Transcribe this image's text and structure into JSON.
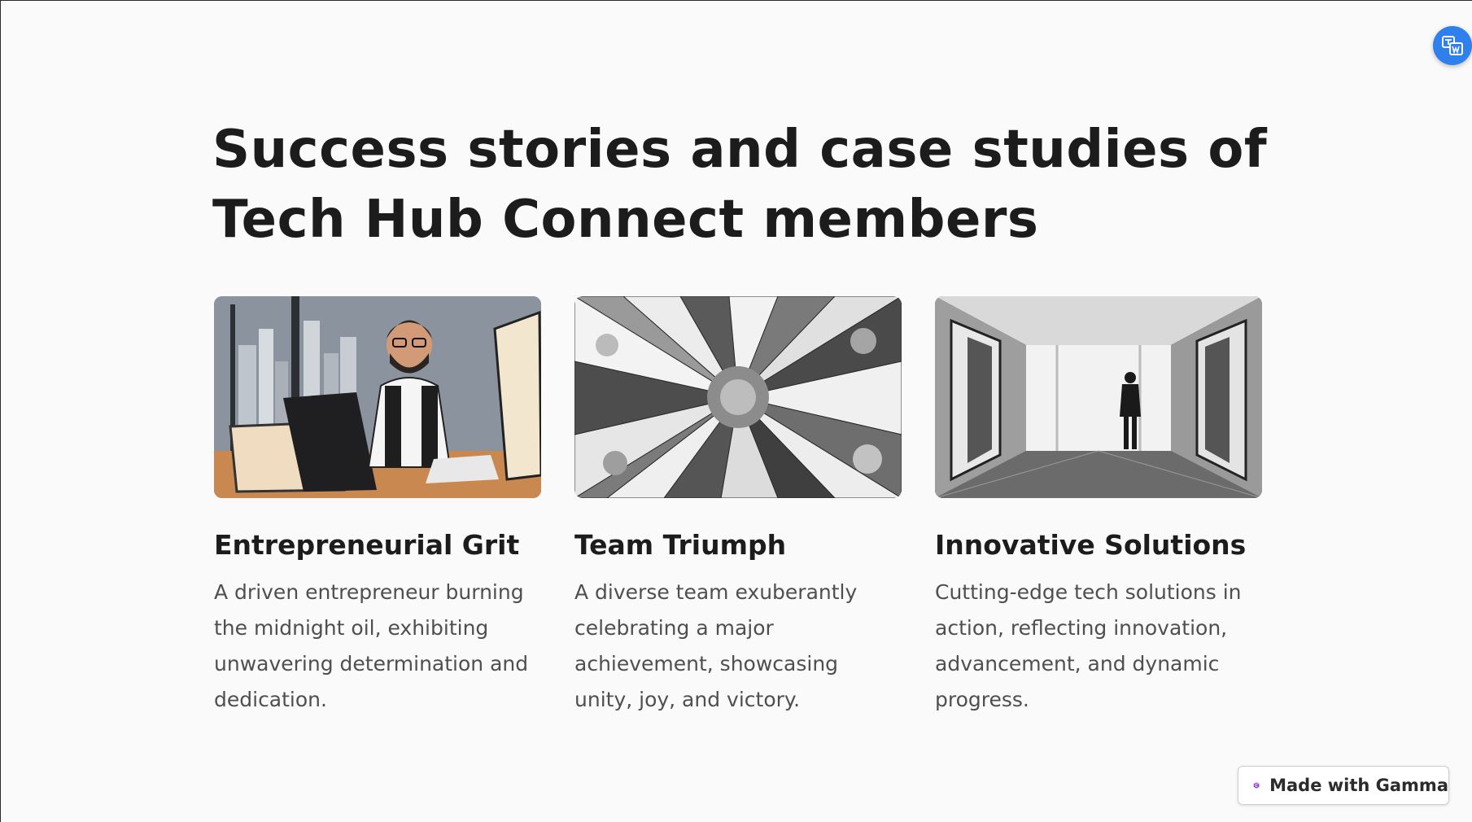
{
  "title": "Success stories and case studies of Tech Hub Connect members",
  "cards": [
    {
      "image_icon": "entrepreneur-at-laptop-illustration",
      "title": "Entrepreneurial Grit",
      "description": "A driven entrepreneur burning the midnight oil, exhibiting unwavering determination and dedication."
    },
    {
      "image_icon": "team-hands-together-photo",
      "title": "Team Triumph",
      "description": "A diverse team exuberantly celebrating a major achievement, showcasing unity, joy, and victory."
    },
    {
      "image_icon": "futuristic-corridor-photo",
      "title": "Innovative Solutions",
      "description": "Cutting-edge tech solutions in action, reflecting innovation, advancement, and dynamic progress."
    }
  ],
  "badge": {
    "label": "Made with Gamma",
    "icon": "gamma-logo-icon"
  },
  "translate_button": {
    "icon": "translate-icon",
    "color": "#2f80ed"
  }
}
